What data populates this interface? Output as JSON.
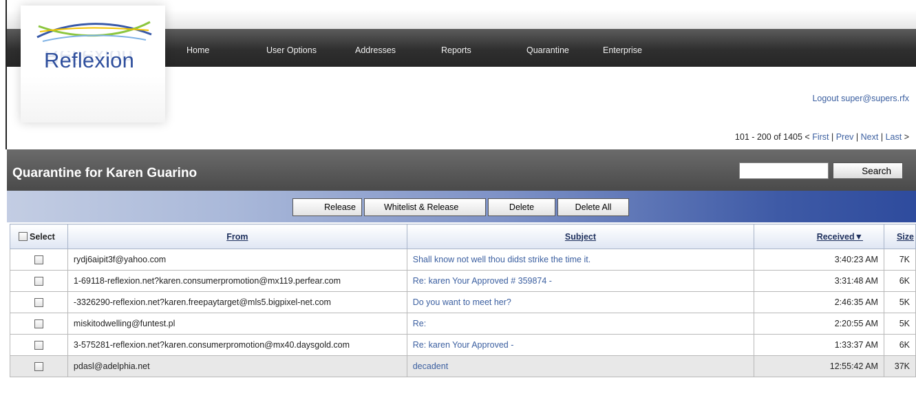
{
  "brand": {
    "logo_text": "Reflexion"
  },
  "nav": {
    "items": [
      {
        "label": "Home"
      },
      {
        "label": "User Options"
      },
      {
        "label": "Addresses"
      },
      {
        "label": "Reports"
      },
      {
        "label": "Quarantine"
      },
      {
        "label": "Enterprise"
      }
    ]
  },
  "account": {
    "logout_label": "Logout super@supers.rfx"
  },
  "pager": {
    "range": "101 - 200 of 1405 <",
    "first": "First",
    "prev": "Prev",
    "next": "Next",
    "last": "Last",
    "sep": "|",
    "end": ">"
  },
  "page": {
    "title": "Quarantine for Karen Guarino"
  },
  "search": {
    "value": "",
    "button_label": "Search"
  },
  "actions": {
    "release": "Release",
    "whitelist_release": "Whitelist & Release",
    "delete": "Delete",
    "delete_all": "Delete All"
  },
  "table": {
    "headers": {
      "select": "Select",
      "from": "From",
      "subject": "Subject",
      "received": "Received▼",
      "size": "Size"
    },
    "rows": [
      {
        "from": "rydj6aipit3f@yahoo.com",
        "subject": "Shall know not well thou didst strike the time it.",
        "received": "3:40:23 AM",
        "size": "7K"
      },
      {
        "from": "1-69118-reflexion.net?karen.consumerpromotion@mx119.perfear.com",
        "subject": "Re: karen Your Approved # 359874 -",
        "received": "3:31:48 AM",
        "size": "6K"
      },
      {
        "from": "-3326290-reflexion.net?karen.freepaytarget@mls5.bigpixel-net.com",
        "subject": "Do you want to meet her?",
        "received": "2:46:35 AM",
        "size": "5K"
      },
      {
        "from": "miskitodwelling@funtest.pl",
        "subject": "Re:",
        "received": "2:20:55 AM",
        "size": "5K"
      },
      {
        "from": "3-575281-reflexion.net?karen.consumerpromotion@mx40.daysgold.com",
        "subject": "Re: karen Your Approved -",
        "received": "1:33:37 AM",
        "size": "6K"
      },
      {
        "from": "pdasl@adelphia.net",
        "subject": "decadent",
        "received": "12:55:42 AM",
        "size": "37K"
      }
    ]
  },
  "colors": {
    "link": "#3b5fa0",
    "logo": "#2f4f9d",
    "nav_bg": "#2f2f2f",
    "title_bg": "#5a5a5a",
    "action_bar_end": "#2e4b9d"
  }
}
